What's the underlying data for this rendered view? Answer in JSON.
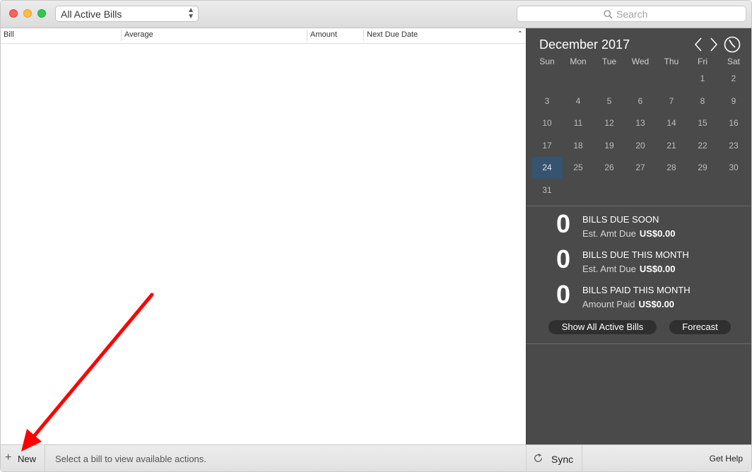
{
  "toolbar": {
    "filter_value": "All Active Bills",
    "search_placeholder": "Search"
  },
  "table": {
    "columns": [
      "Bill",
      "Average",
      "Amount",
      "Next Due Date"
    ],
    "rows": []
  },
  "calendar": {
    "month_label": "December 2017",
    "weekdays": [
      "Sun",
      "Mon",
      "Tue",
      "Wed",
      "Thu",
      "Fri",
      "Sat"
    ],
    "days": [
      "1",
      "2",
      "3",
      "4",
      "5",
      "6",
      "7",
      "8",
      "9",
      "10",
      "11",
      "12",
      "13",
      "14",
      "15",
      "16",
      "17",
      "18",
      "19",
      "20",
      "21",
      "22",
      "23",
      "24",
      "25",
      "26",
      "27",
      "28",
      "29",
      "30",
      "31"
    ],
    "first_weekday_index": 5,
    "today": "24"
  },
  "stats": [
    {
      "count": "0",
      "title": "BILLS DUE SOON",
      "sub_label": "Est. Amt Due",
      "sub_value": "US$0.00"
    },
    {
      "count": "0",
      "title": "BILLS DUE THIS MONTH",
      "sub_label": "Est. Amt Due",
      "sub_value": "US$0.00"
    },
    {
      "count": "0",
      "title": "BILLS PAID THIS MONTH",
      "sub_label": "Amount Paid",
      "sub_value": "US$0.00"
    }
  ],
  "actions": {
    "show_all": "Show All Active Bills",
    "forecast": "Forecast"
  },
  "bottom": {
    "new_label": "New",
    "message": "Select a bill to view available actions.",
    "sync_label": "Sync",
    "help_label": "Get Help"
  },
  "colors": {
    "sidebar_bg": "#4a4a4a",
    "today_highlight": "#36536f",
    "annotation_arrow": "#ff0000"
  }
}
